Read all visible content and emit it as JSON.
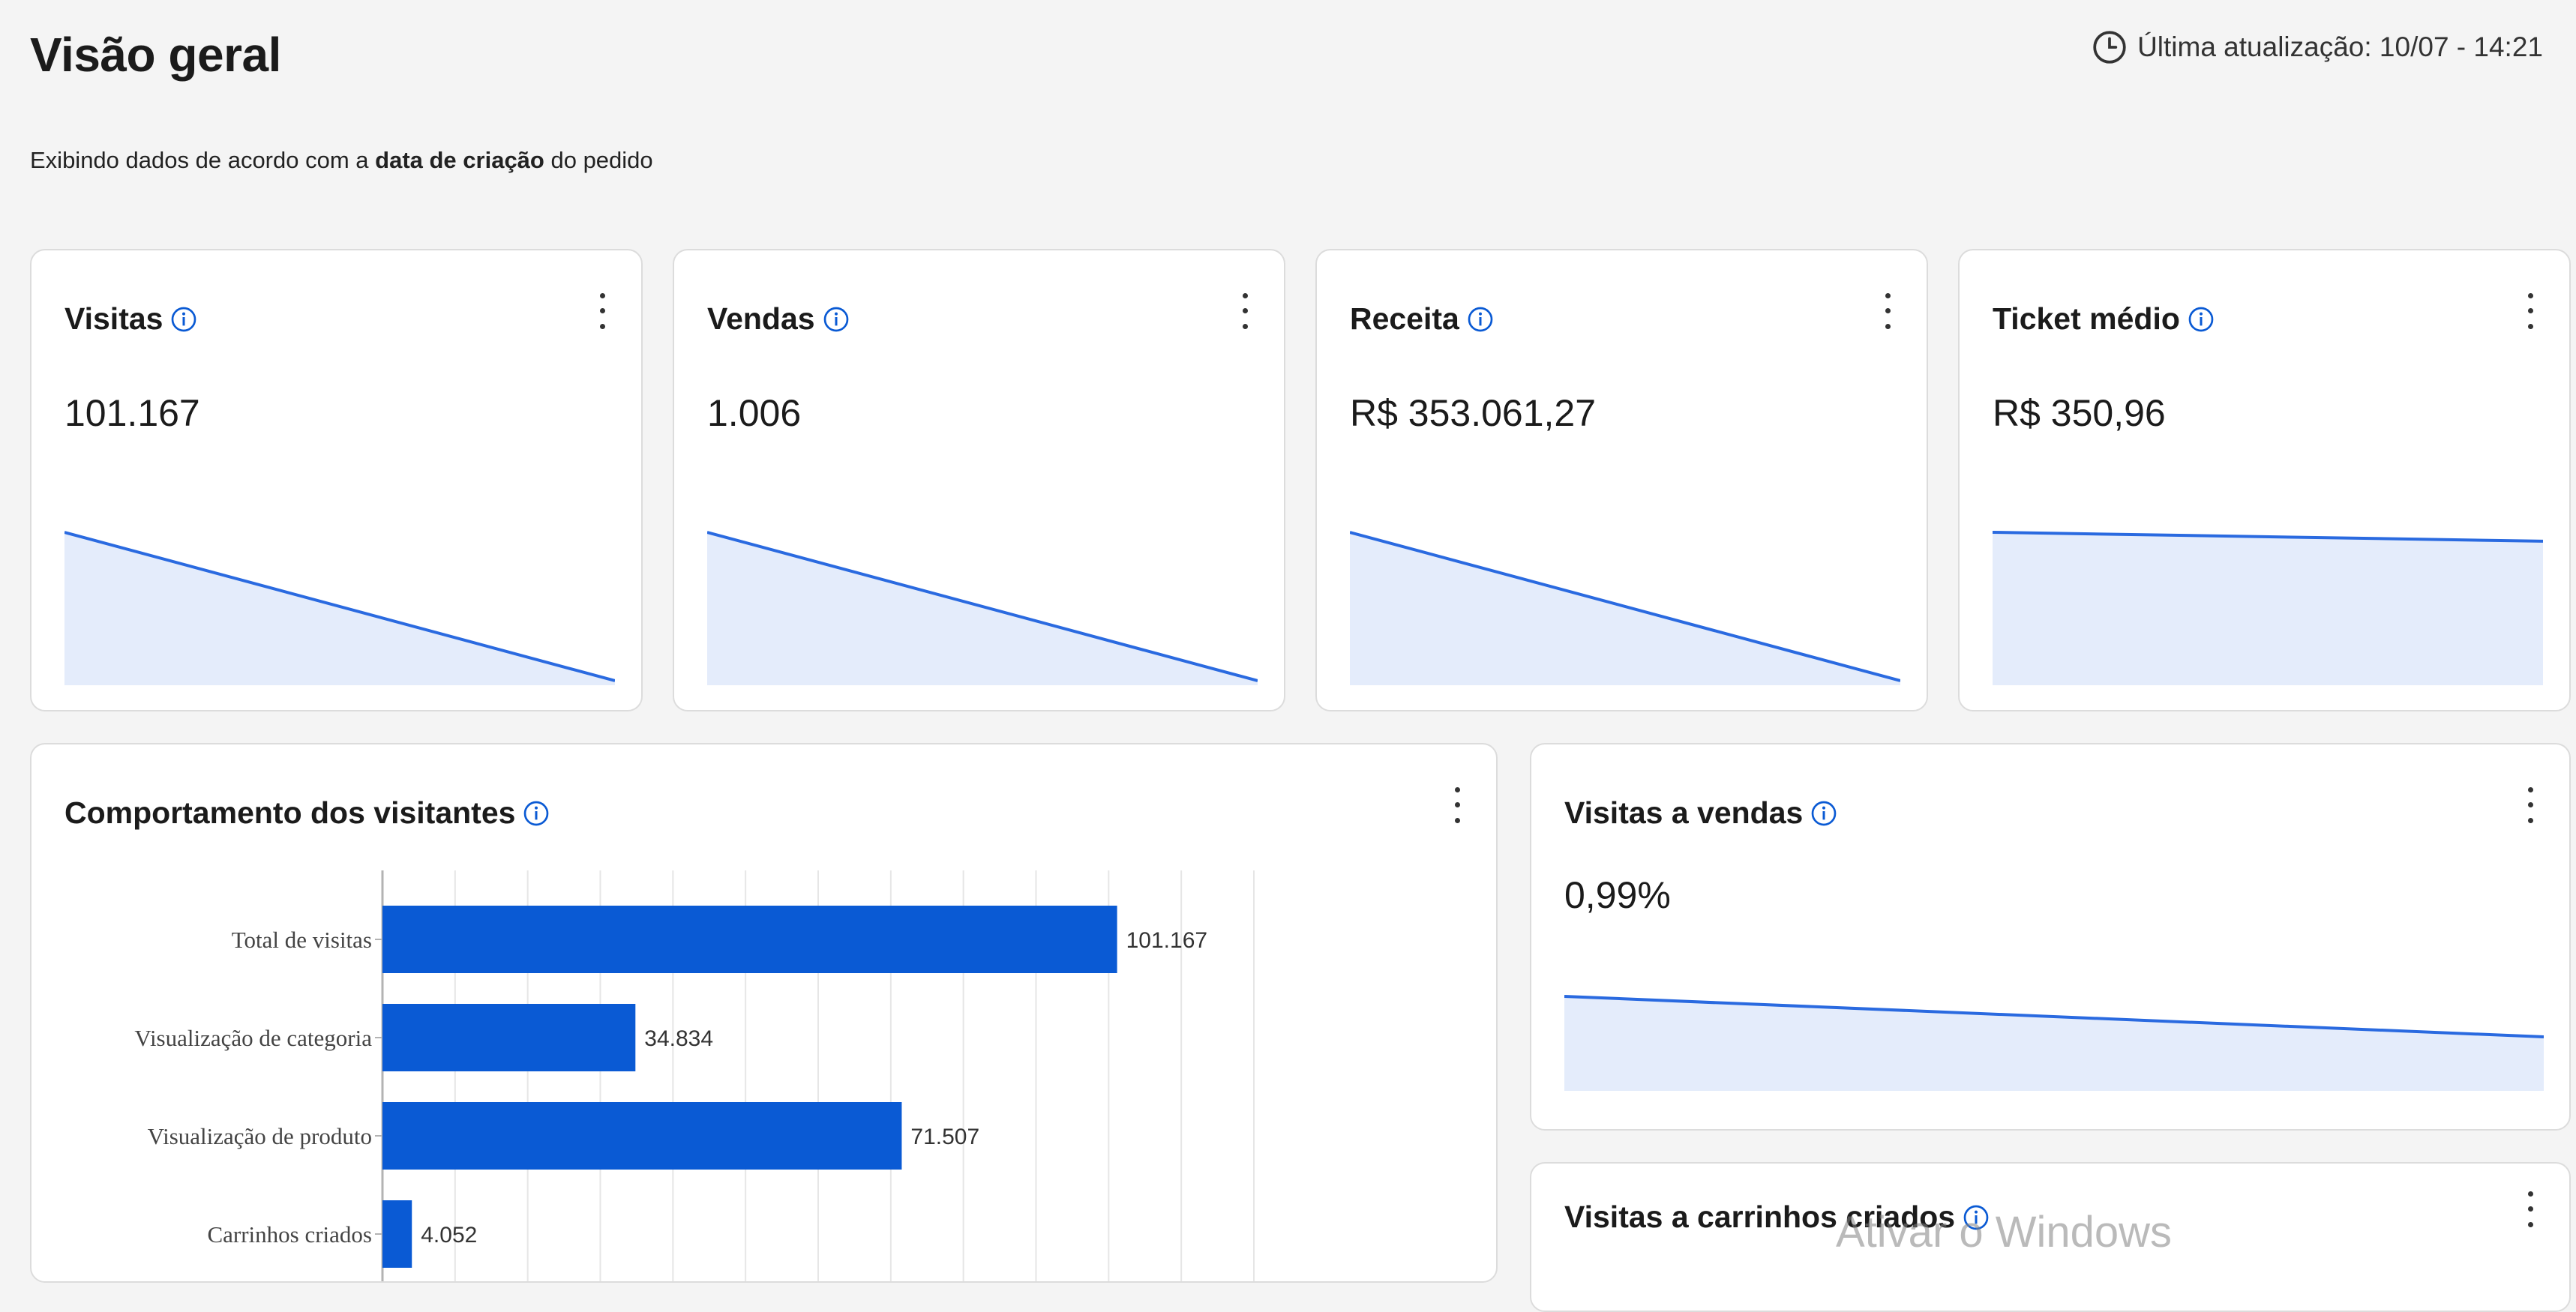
{
  "header": {
    "title": "Visão geral",
    "last_update": "Última atualização: 10/07 - 14:21",
    "subtitle_prefix": "Exibindo dados de acordo com a ",
    "subtitle_bold": "data de criação",
    "subtitle_suffix": " do pedido"
  },
  "metrics": [
    {
      "title": "Visitas",
      "value": "101.167",
      "trend": [
        1.0,
        0.0
      ]
    },
    {
      "title": "Vendas",
      "value": "1.006",
      "trend": [
        1.0,
        0.0
      ]
    },
    {
      "title": "Receita",
      "value": "R$ 353.061,27",
      "trend": [
        1.0,
        0.0
      ]
    },
    {
      "title": "Ticket médio",
      "value": "R$ 350,96",
      "trend": [
        1.0,
        0.94
      ]
    }
  ],
  "behavior": {
    "title": "Comportamento dos visitantes"
  },
  "conversion": {
    "title": "Visitas a vendas",
    "value": "0,99%",
    "trend": [
      1.0,
      0.55
    ]
  },
  "cart": {
    "title": "Visitas a carrinhos criados"
  },
  "watermark": "Ativar o Windows",
  "colors": {
    "accent": "#0a5ad4",
    "bar": "#0a5ad4",
    "area_fill": "#e4ecfb",
    "line": "#2a6ae0"
  },
  "chart_data": {
    "type": "bar",
    "orientation": "horizontal",
    "categories": [
      "Total de visitas",
      "Visualização de categoria",
      "Visualização de produto",
      "Carrinhos criados"
    ],
    "values": [
      101167,
      34834,
      71507,
      4052
    ],
    "value_labels": [
      "101.167",
      "34.834",
      "71.507",
      "4.052"
    ],
    "xlim": [
      0,
      120000
    ],
    "grid": true
  }
}
